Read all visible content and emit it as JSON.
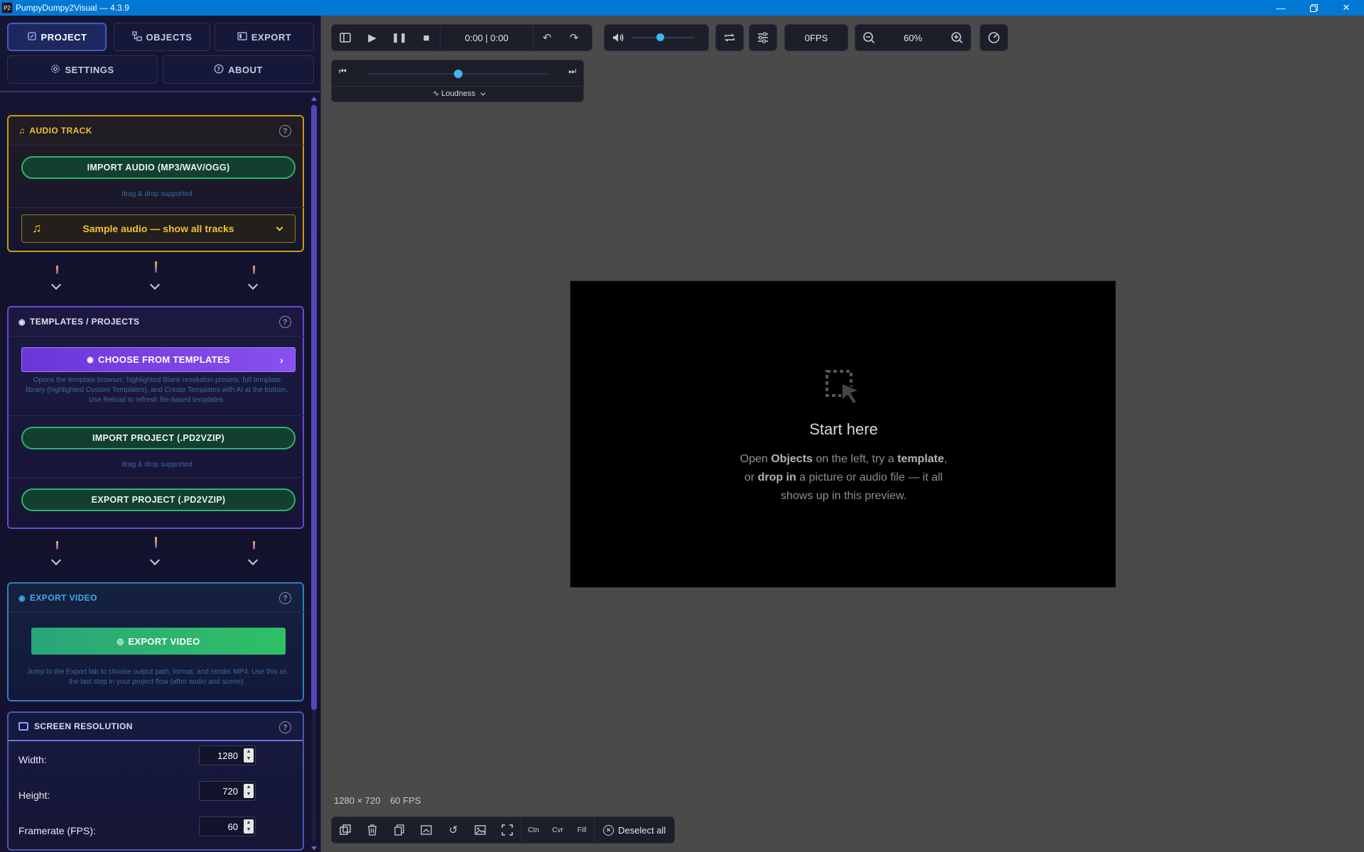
{
  "window": {
    "title": "PumpyDumpy2Visual — 4.3.9",
    "icon_text": "P2"
  },
  "tabs": {
    "project": "PROJECT",
    "objects": "OBJECTS",
    "export": "EXPORT",
    "settings": "SETTINGS",
    "about": "ABOUT"
  },
  "audio": {
    "title": "AUDIO TRACK",
    "import_label": "IMPORT AUDIO (MP3/WAV/OGG)",
    "drag_hint": "drag & drop supported",
    "sample_label": "Sample audio — show all tracks"
  },
  "templates": {
    "title": "TEMPLATES / PROJECTS",
    "choose_label": "CHOOSE FROM TEMPLATES",
    "choose_desc": "Opens the template browser: highlighted Blank resolution presets, full template library (highlighted Custom Templates), and Create Templates with AI at the bottom. Use Reload to refresh file-based templates.",
    "import_label": "IMPORT PROJECT (.PD2VZIP)",
    "drag_hint": "drag & drop supported",
    "export_label": "EXPORT PROJECT (.PD2VZIP)"
  },
  "export_video": {
    "title": "EXPORT VIDEO",
    "button_label": "EXPORT VIDEO",
    "desc": "Jump to the Export tab to choose output path, format, and render MP4. Use this as the last step in your project flow (after audio and scene)."
  },
  "resolution": {
    "title": "SCREEN RESOLUTION",
    "width_label": "Width:",
    "width_value": "1280",
    "height_label": "Height:",
    "height_value": "720",
    "fps_label": "Framerate (FPS):",
    "fps_value": "60"
  },
  "toolbar": {
    "time": "0:00 | 0:00",
    "fps": "0FPS",
    "zoom": "60%",
    "volume_level": 0.45
  },
  "playhead": {
    "mode_label": "Loudness",
    "position": 0.5
  },
  "canvas": {
    "title": "Start here",
    "line1_a": "Open ",
    "line1_b": "Objects",
    "line1_c": " on the left, try a ",
    "line1_d": "template",
    "line1_e": ",",
    "line2_a": "or ",
    "line2_b": "drop in",
    "line2_c": " a picture or audio file — it all",
    "line3": "shows up in this preview."
  },
  "status": {
    "resolution": "1280 × 720",
    "fps": "60 FPS"
  },
  "bottom": {
    "ctn": "Ctn",
    "cvr": "Cvr",
    "fill": "Fill",
    "deselect": "Deselect all"
  },
  "colors": {
    "accent_gold": "#e8b420",
    "accent_purple": "#7c4ef0",
    "accent_green": "#2fb36a",
    "accent_blue": "#3aa0e8",
    "titlebar": "#0078d4"
  }
}
